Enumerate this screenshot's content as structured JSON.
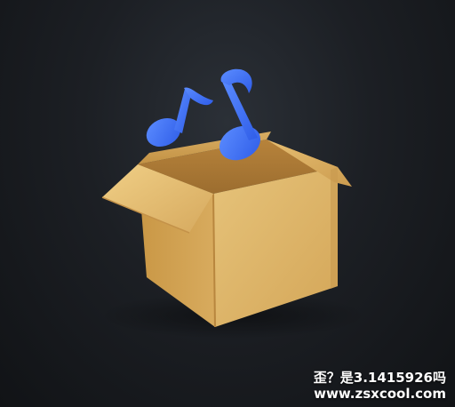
{
  "watermark": {
    "line1": "歪？是3.1415926吗",
    "line2": "www.zsxcool.com"
  },
  "icon": {
    "name": "music-box-icon",
    "colors": {
      "box_light": "#e9c47a",
      "box_mid": "#d6a85a",
      "box_dark": "#b8863e",
      "note": "#4a7cff",
      "note_dark": "#2f5de8"
    }
  }
}
